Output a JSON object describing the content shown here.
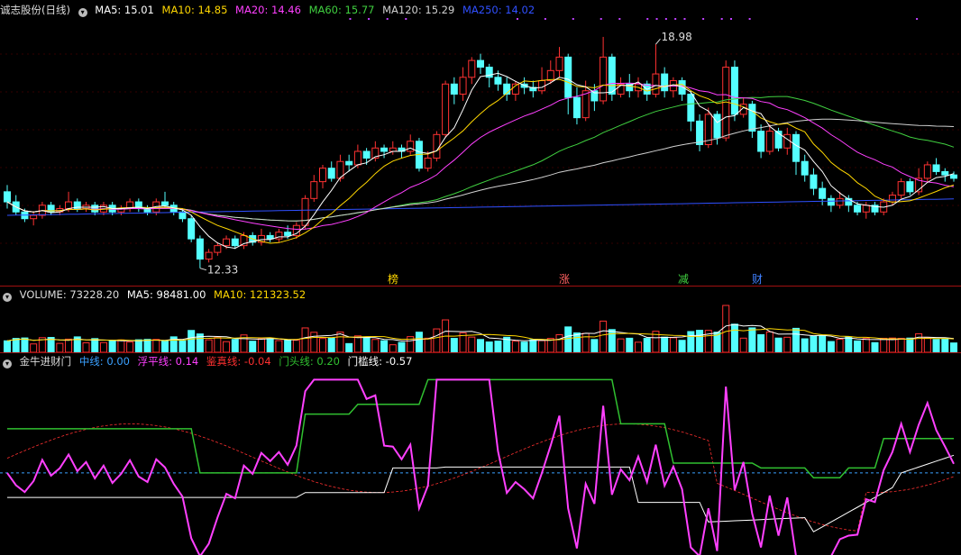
{
  "stock": {
    "title": "诚志股份(日线)",
    "ma": [
      {
        "label": "MA5: 15.01",
        "color": "#ffffff"
      },
      {
        "label": "MA10: 14.85",
        "color": "#ffd700"
      },
      {
        "label": "MA20: 14.46",
        "color": "#ff40ff"
      },
      {
        "label": "MA60: 15.77",
        "color": "#40d040"
      },
      {
        "label": "MA120: 15.29",
        "color": "#d0d0d0"
      },
      {
        "label": "MA250: 14.02",
        "color": "#3050ff"
      }
    ],
    "high_label": "18.98",
    "low_label": "12.33",
    "badges": [
      {
        "text": "榜",
        "color": "#ffd700"
      },
      {
        "text": "涨",
        "color": "#ff6060"
      },
      {
        "text": "减",
        "color": "#40d040"
      },
      {
        "text": "财",
        "color": "#4080ff"
      }
    ]
  },
  "volume": {
    "label": "VOLUME: 73228.20",
    "ma5": "MA5: 98481.00",
    "ma10": "MA10: 121323.52"
  },
  "indicator": {
    "name": "金牛进财门",
    "items": [
      {
        "label": "中线: 0.00",
        "color": "#3aa0ff"
      },
      {
        "label": "浮平线: 0.14",
        "color": "#ff40ff"
      },
      {
        "label": "鉴真线: -0.04",
        "color": "#ff3030"
      },
      {
        "label": "门头线: 0.20",
        "color": "#30c030"
      },
      {
        "label": "门槛线: -0.57",
        "color": "#ffffff"
      }
    ]
  },
  "chart_data": {
    "type": "candlestick",
    "candles": [
      [
        14.6,
        14.3,
        14.8,
        14.1
      ],
      [
        14.3,
        14.0,
        14.5,
        13.9
      ],
      [
        14.0,
        13.8,
        14.1,
        13.7
      ],
      [
        13.8,
        13.9,
        14.0,
        13.6
      ],
      [
        13.9,
        14.2,
        14.3,
        13.8
      ],
      [
        14.2,
        14.0,
        14.3,
        13.9
      ],
      [
        14.0,
        14.1,
        14.2,
        13.9
      ],
      [
        14.1,
        14.3,
        14.6,
        14.0
      ],
      [
        14.3,
        14.1,
        14.4,
        14.0
      ],
      [
        14.1,
        14.2,
        14.3,
        14.0
      ],
      [
        14.2,
        14.0,
        14.3,
        13.9
      ],
      [
        14.0,
        14.2,
        14.3,
        13.9
      ],
      [
        14.2,
        14.0,
        14.3,
        13.9
      ],
      [
        14.0,
        14.1,
        14.2,
        13.9
      ],
      [
        14.1,
        14.3,
        14.4,
        14.0
      ],
      [
        14.3,
        14.1,
        14.4,
        14.0
      ],
      [
        14.1,
        14.0,
        14.2,
        13.9
      ],
      [
        14.0,
        14.3,
        14.4,
        13.9
      ],
      [
        14.3,
        14.2,
        14.6,
        14.1
      ],
      [
        14.2,
        14.0,
        14.3,
        13.9
      ],
      [
        14.0,
        13.8,
        14.1,
        13.7
      ],
      [
        13.8,
        13.2,
        13.9,
        13.1
      ],
      [
        13.2,
        12.6,
        13.3,
        12.33
      ],
      [
        12.6,
        12.8,
        12.9,
        12.5
      ],
      [
        12.8,
        13.0,
        13.1,
        12.7
      ],
      [
        13.0,
        13.2,
        13.3,
        12.9
      ],
      [
        13.2,
        13.0,
        13.3,
        12.9
      ],
      [
        13.0,
        13.3,
        13.4,
        12.9
      ],
      [
        13.3,
        13.1,
        13.4,
        13.0
      ],
      [
        13.1,
        13.3,
        13.5,
        13.0
      ],
      [
        13.3,
        13.2,
        13.4,
        13.1
      ],
      [
        13.2,
        13.4,
        13.5,
        13.1
      ],
      [
        13.4,
        13.3,
        13.6,
        13.2
      ],
      [
        13.3,
        13.6,
        13.7,
        13.2
      ],
      [
        13.6,
        14.4,
        14.5,
        13.5
      ],
      [
        14.4,
        14.9,
        15.1,
        14.3
      ],
      [
        14.9,
        15.3,
        15.4,
        14.7
      ],
      [
        15.3,
        15.0,
        15.5,
        14.9
      ],
      [
        15.0,
        15.5,
        15.7,
        14.9
      ],
      [
        15.5,
        15.4,
        15.7,
        15.2
      ],
      [
        15.4,
        15.8,
        16.0,
        15.3
      ],
      [
        15.8,
        15.6,
        15.9,
        15.4
      ],
      [
        15.6,
        15.9,
        16.1,
        15.5
      ],
      [
        15.9,
        15.8,
        16.0,
        15.6
      ],
      [
        15.8,
        15.9,
        16.1,
        15.7
      ],
      [
        15.9,
        15.8,
        16.0,
        15.6
      ],
      [
        15.8,
        16.1,
        16.3,
        15.7
      ],
      [
        16.1,
        15.3,
        16.2,
        15.2
      ],
      [
        15.3,
        15.6,
        15.8,
        15.2
      ],
      [
        15.6,
        16.3,
        16.4,
        15.5
      ],
      [
        16.3,
        17.8,
        17.9,
        16.2
      ],
      [
        17.8,
        17.5,
        18.0,
        17.2
      ],
      [
        17.5,
        18.0,
        18.3,
        17.3
      ],
      [
        18.0,
        18.5,
        18.6,
        17.8
      ],
      [
        18.5,
        18.3,
        18.7,
        18.1
      ],
      [
        18.3,
        18.0,
        18.4,
        17.7
      ],
      [
        18.0,
        17.8,
        18.2,
        17.6
      ],
      [
        17.8,
        17.5,
        18.0,
        17.3
      ],
      [
        17.5,
        17.8,
        17.9,
        17.3
      ],
      [
        17.8,
        17.7,
        18.0,
        17.5
      ],
      [
        17.7,
        17.6,
        17.9,
        17.4
      ],
      [
        17.6,
        17.9,
        18.3,
        17.5
      ],
      [
        17.9,
        18.2,
        18.5,
        17.8
      ],
      [
        18.2,
        18.6,
        18.9,
        18.0
      ],
      [
        18.6,
        17.4,
        18.7,
        16.9
      ],
      [
        17.4,
        16.8,
        17.7,
        16.6
      ],
      [
        16.8,
        17.6,
        17.9,
        16.7
      ],
      [
        17.6,
        17.3,
        17.8,
        17.0
      ],
      [
        17.3,
        18.6,
        19.2,
        17.2
      ],
      [
        18.6,
        17.5,
        18.7,
        17.3
      ],
      [
        17.5,
        17.8,
        18.0,
        17.4
      ],
      [
        17.8,
        17.6,
        18.1,
        17.4
      ],
      [
        17.6,
        17.8,
        18.0,
        17.4
      ],
      [
        17.8,
        17.5,
        17.9,
        17.3
      ],
      [
        17.5,
        18.1,
        18.98,
        17.4
      ],
      [
        18.1,
        17.6,
        18.3,
        17.4
      ],
      [
        17.6,
        17.9,
        18.0,
        17.4
      ],
      [
        17.9,
        17.5,
        18.0,
        17.3
      ],
      [
        17.5,
        16.7,
        17.6,
        16.4
      ],
      [
        16.7,
        16.0,
        16.9,
        15.8
      ],
      [
        16.0,
        16.9,
        17.1,
        15.9
      ],
      [
        16.9,
        16.2,
        17.0,
        16.0
      ],
      [
        16.2,
        18.3,
        18.5,
        16.1
      ],
      [
        18.3,
        16.9,
        18.5,
        16.7
      ],
      [
        16.9,
        17.2,
        17.4,
        16.8
      ],
      [
        17.2,
        16.4,
        17.3,
        16.2
      ],
      [
        16.4,
        15.8,
        16.6,
        15.6
      ],
      [
        15.8,
        16.4,
        16.6,
        15.7
      ],
      [
        16.4,
        15.9,
        16.5,
        15.8
      ],
      [
        15.9,
        16.3,
        16.5,
        15.7
      ],
      [
        16.3,
        15.5,
        16.4,
        15.1
      ],
      [
        15.5,
        15.1,
        15.7,
        14.9
      ],
      [
        15.1,
        14.7,
        15.3,
        14.5
      ],
      [
        14.7,
        14.4,
        14.9,
        14.2
      ],
      [
        14.4,
        14.2,
        14.5,
        14.0
      ],
      [
        14.2,
        14.4,
        14.6,
        14.1
      ],
      [
        14.4,
        14.2,
        14.5,
        14.0
      ],
      [
        14.2,
        14.0,
        14.3,
        13.9
      ],
      [
        14.0,
        14.2,
        14.3,
        13.8
      ],
      [
        14.2,
        14.0,
        14.3,
        13.9
      ],
      [
        14.0,
        14.3,
        14.4,
        13.9
      ],
      [
        14.3,
        14.5,
        14.6,
        14.2
      ],
      [
        14.5,
        14.9,
        15.0,
        14.4
      ],
      [
        14.9,
        14.6,
        15.0,
        14.5
      ],
      [
        14.6,
        15.0,
        15.3,
        14.5
      ],
      [
        15.0,
        15.4,
        15.5,
        14.9
      ],
      [
        15.4,
        15.2,
        15.6,
        15.1
      ],
      [
        15.2,
        15.1,
        15.3,
        14.9
      ],
      [
        15.1,
        15.0,
        15.2,
        14.9
      ]
    ]
  }
}
